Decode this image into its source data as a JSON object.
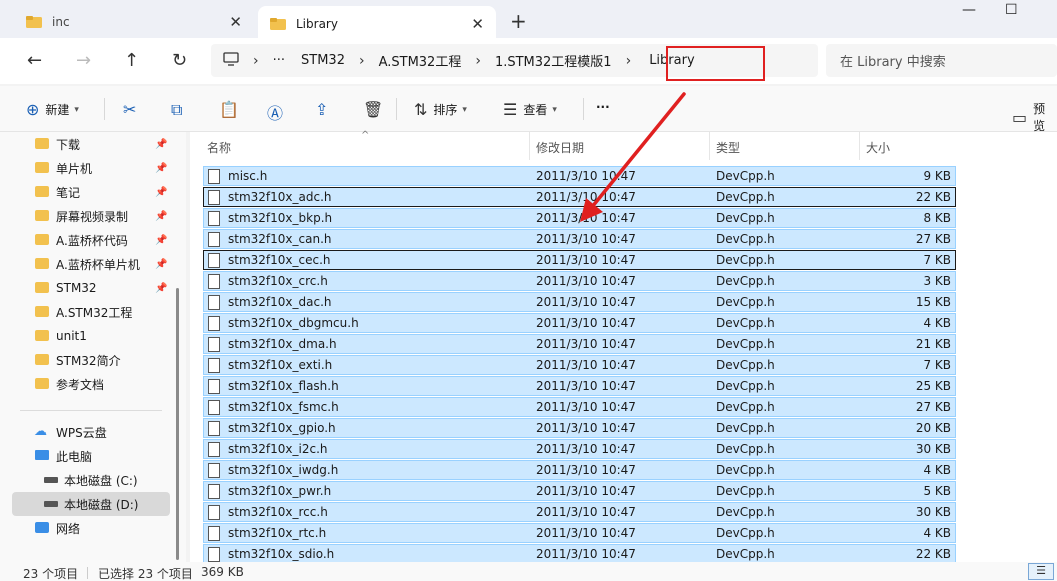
{
  "tabs": [
    {
      "label": "inc",
      "active": false
    },
    {
      "label": "Library",
      "active": true
    }
  ],
  "window": {
    "minimize": "—",
    "maximize": "☐"
  },
  "breadcrumb": {
    "more": "···",
    "items": [
      "STM32",
      "A.STM32工程",
      "1.STM32工程模版1",
      "Library"
    ]
  },
  "search": {
    "placeholder": "在 Library 中搜索"
  },
  "toolbar": {
    "new_label": "新建",
    "sort_label": "排序",
    "view_label": "查看",
    "more_label": "···",
    "preview_label": "预览"
  },
  "sidebar": {
    "quick_access": [
      {
        "label": "下载",
        "pinned": true
      },
      {
        "label": "单片机",
        "pinned": true
      },
      {
        "label": "笔记",
        "pinned": true
      },
      {
        "label": "屏幕视频录制",
        "pinned": true
      },
      {
        "label": "A.蓝桥杯代码",
        "pinned": true
      },
      {
        "label": "A.蓝桥杯单片机",
        "pinned": true
      },
      {
        "label": "STM32",
        "pinned": true
      },
      {
        "label": "A.STM32工程",
        "pinned": false
      },
      {
        "label": "unit1",
        "pinned": false
      },
      {
        "label": "STM32简介",
        "pinned": false
      },
      {
        "label": "参考文档",
        "pinned": false
      }
    ],
    "locations": [
      {
        "label": "WPS云盘"
      },
      {
        "label": "此电脑"
      },
      {
        "label": "本地磁盘 (C:)"
      },
      {
        "label": "本地磁盘 (D:)",
        "selected": true
      },
      {
        "label": "网络"
      }
    ]
  },
  "columns": {
    "name": "名称",
    "date": "修改日期",
    "type": "类型",
    "size": "大小"
  },
  "files": [
    {
      "name": "misc.h",
      "date": "2011/3/10 10:47",
      "type": "DevCpp.h",
      "size": "9 KB"
    },
    {
      "name": "stm32f10x_adc.h",
      "date": "2011/3/10 10:47",
      "type": "DevCpp.h",
      "size": "22 KB"
    },
    {
      "name": "stm32f10x_bkp.h",
      "date": "2011/3/10 10:47",
      "type": "DevCpp.h",
      "size": "8 KB"
    },
    {
      "name": "stm32f10x_can.h",
      "date": "2011/3/10 10:47",
      "type": "DevCpp.h",
      "size": "27 KB"
    },
    {
      "name": "stm32f10x_cec.h",
      "date": "2011/3/10 10:47",
      "type": "DevCpp.h",
      "size": "7 KB"
    },
    {
      "name": "stm32f10x_crc.h",
      "date": "2011/3/10 10:47",
      "type": "DevCpp.h",
      "size": "3 KB"
    },
    {
      "name": "stm32f10x_dac.h",
      "date": "2011/3/10 10:47",
      "type": "DevCpp.h",
      "size": "15 KB"
    },
    {
      "name": "stm32f10x_dbgmcu.h",
      "date": "2011/3/10 10:47",
      "type": "DevCpp.h",
      "size": "4 KB"
    },
    {
      "name": "stm32f10x_dma.h",
      "date": "2011/3/10 10:47",
      "type": "DevCpp.h",
      "size": "21 KB"
    },
    {
      "name": "stm32f10x_exti.h",
      "date": "2011/3/10 10:47",
      "type": "DevCpp.h",
      "size": "7 KB"
    },
    {
      "name": "stm32f10x_flash.h",
      "date": "2011/3/10 10:47",
      "type": "DevCpp.h",
      "size": "25 KB"
    },
    {
      "name": "stm32f10x_fsmc.h",
      "date": "2011/3/10 10:47",
      "type": "DevCpp.h",
      "size": "27 KB"
    },
    {
      "name": "stm32f10x_gpio.h",
      "date": "2011/3/10 10:47",
      "type": "DevCpp.h",
      "size": "20 KB"
    },
    {
      "name": "stm32f10x_i2c.h",
      "date": "2011/3/10 10:47",
      "type": "DevCpp.h",
      "size": "30 KB"
    },
    {
      "name": "stm32f10x_iwdg.h",
      "date": "2011/3/10 10:47",
      "type": "DevCpp.h",
      "size": "4 KB"
    },
    {
      "name": "stm32f10x_pwr.h",
      "date": "2011/3/10 10:47",
      "type": "DevCpp.h",
      "size": "5 KB"
    },
    {
      "name": "stm32f10x_rcc.h",
      "date": "2011/3/10 10:47",
      "type": "DevCpp.h",
      "size": "30 KB"
    },
    {
      "name": "stm32f10x_rtc.h",
      "date": "2011/3/10 10:47",
      "type": "DevCpp.h",
      "size": "4 KB"
    },
    {
      "name": "stm32f10x_sdio.h",
      "date": "2011/3/10 10:47",
      "type": "DevCpp.h",
      "size": "22 KB"
    }
  ],
  "status": {
    "count": "23 个项目",
    "selected": "已选择 23 个项目",
    "size": "369 KB"
  },
  "colors": {
    "selection": "#cce8ff",
    "selection_border": "#99d1ff",
    "annotation": "#e02020",
    "folder": "#f2c14e"
  }
}
